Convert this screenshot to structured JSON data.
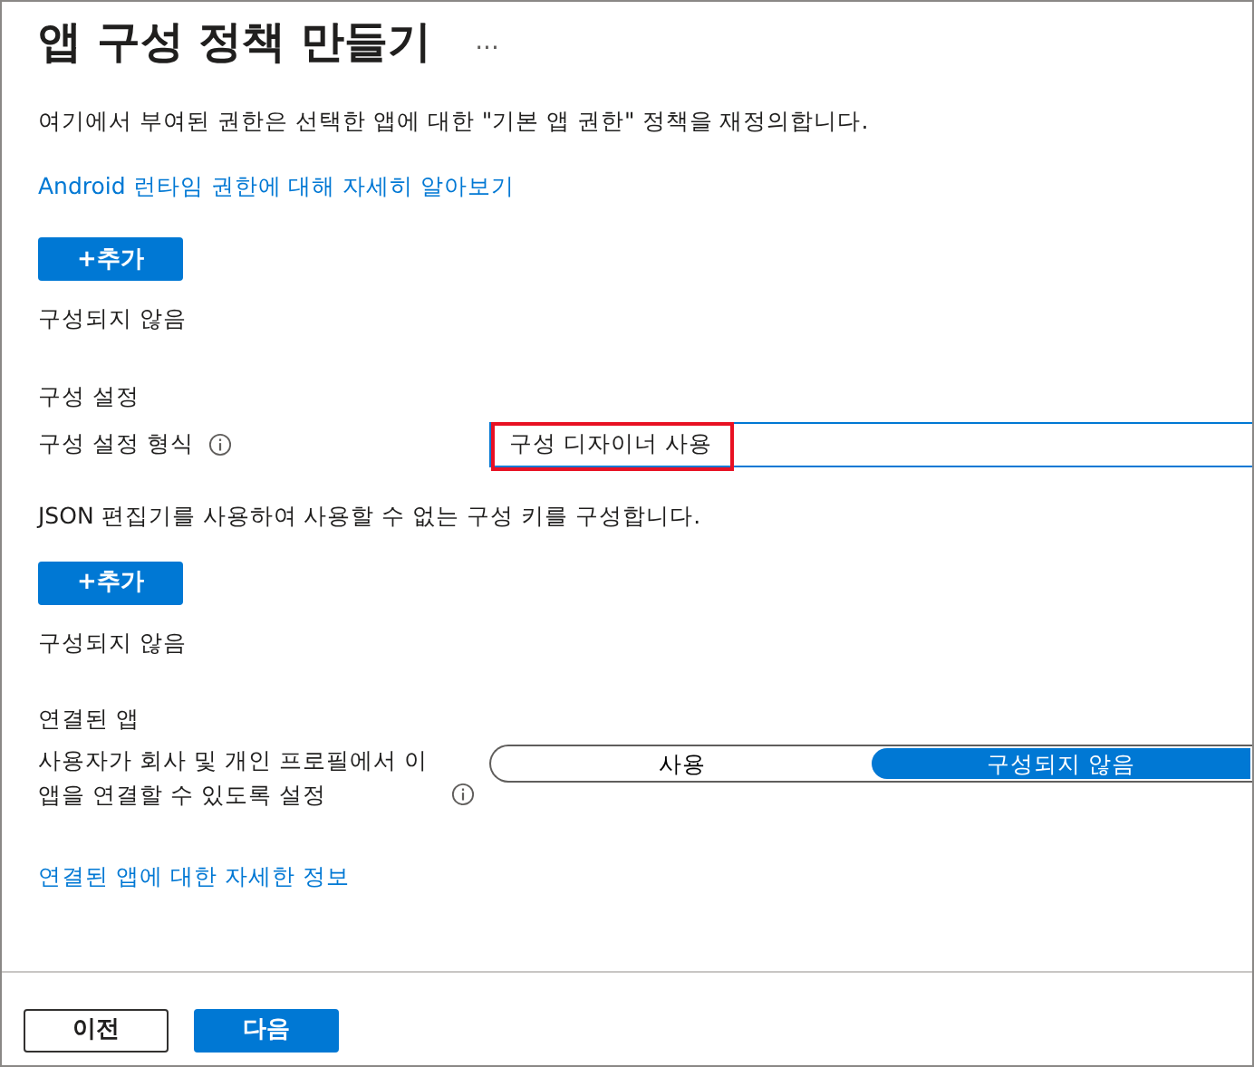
{
  "title": "앱 구성 정책 만들기",
  "more": "...",
  "description": "여기에서 부여된 권한은 선택한 앱에 대한 \"기본 앱 권한\" 정책을 재정의합니다.",
  "learn_link": "Android 런타임 권한에 대해 자세히 알아보기",
  "permissions": {
    "add_button": "+추가",
    "status": "구성되지 않음"
  },
  "config_settings": {
    "heading": "구성 설정",
    "format_label": "구성 설정 형식",
    "format_value": "구성 디자이너 사용",
    "highlighted": true,
    "json_note": "JSON 편집기를 사용하여 사용할 수 없는 구성 키를 구성합니다.",
    "add_button": "+추가",
    "status": "구성되지 않음"
  },
  "connected_apps": {
    "heading": "연결된 앱",
    "setting_label": "사용자가 회사 및 개인 프로필에서 이 앱을 연결할 수 있도록 설정",
    "options": [
      {
        "label": "사용",
        "selected": false
      },
      {
        "label": "구성되지 않음",
        "selected": true
      }
    ],
    "link": "연결된 앱에 대한 자세한 정보"
  },
  "footer": {
    "buttons": [
      {
        "label": "이전",
        "kind": "secondary"
      },
      {
        "label": "다음",
        "kind": "primary"
      }
    ]
  }
}
